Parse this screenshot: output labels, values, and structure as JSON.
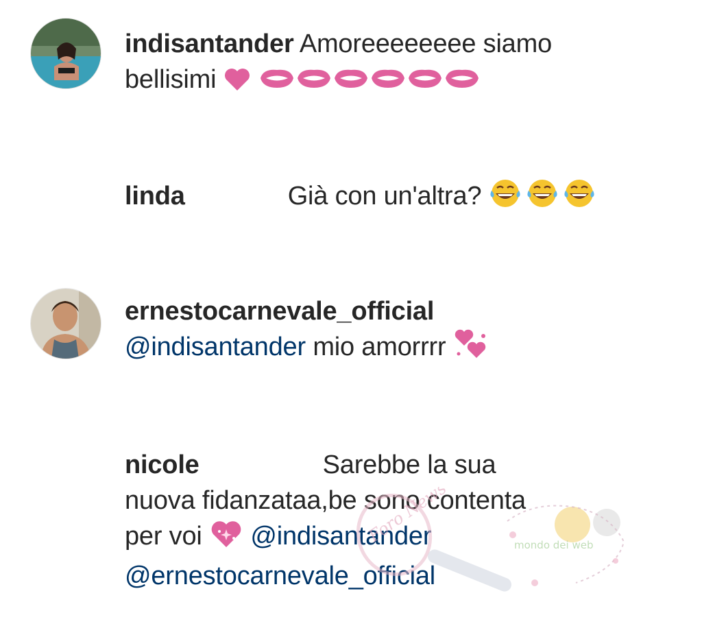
{
  "comments": [
    {
      "username": "indisantander",
      "text_line1": "Amoreeeeeeee siamo",
      "text_line2": "bellisimi"
    },
    {
      "username": "linda",
      "text": "Già con un'altra?"
    },
    {
      "username": "ernestocarnevale_official",
      "mention": "@indisantander",
      "text": "mio amorrrr"
    },
    {
      "username": "nicole",
      "text_line1": "Sarebbe la sua",
      "text_line2": "nuova fidanzataa,be sono contenta",
      "text_line3": "per voi",
      "mention1": "@indisantander",
      "mention2": "@ernestocarnevale_official"
    }
  ],
  "watermark": {
    "stamp": "Foro News",
    "script": "mondo dei web"
  },
  "colors": {
    "mention": "#003569",
    "emoji_pink": "#e0609d",
    "emoji_yellow": "#f5c42e"
  },
  "icons": [
    "heart-icon",
    "kiss-icon",
    "laughing-tears-icon",
    "two-hearts-icon",
    "sparkling-heart-icon"
  ]
}
